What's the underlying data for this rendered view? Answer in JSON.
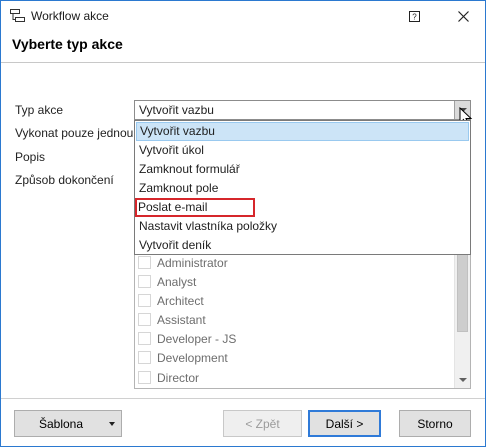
{
  "window": {
    "title": "Workflow akce",
    "help_label": "?",
    "heading": "Vyberte typ akce"
  },
  "form": {
    "labels": {
      "typ_akce": "Typ akce",
      "vykonat": "Vykonat pouze jednou",
      "popis": "Popis",
      "zpusob": "Způsob dokončení"
    },
    "typ_akce_value": "Vytvořit vazbu"
  },
  "dropdown": {
    "options": [
      "Vytvořit vazbu",
      "Vytvořit úkol",
      "Zamknout formulář",
      "Zamknout pole",
      "Poslat e-mail",
      "Nastavit vlastníka položky",
      "Vytvořit deník"
    ],
    "selected_index": 0,
    "highlighted_index": 4,
    "highlight_color": "#d6262b"
  },
  "roles": {
    "items": [
      "Administrator",
      "Analyst",
      "Architect",
      "Assistant",
      "Developer - JS",
      "Development",
      "Director"
    ]
  },
  "buttons": {
    "sablona": "Šablona",
    "zpet": "< Zpět",
    "dalsi": "Další >",
    "storno": "Storno"
  }
}
